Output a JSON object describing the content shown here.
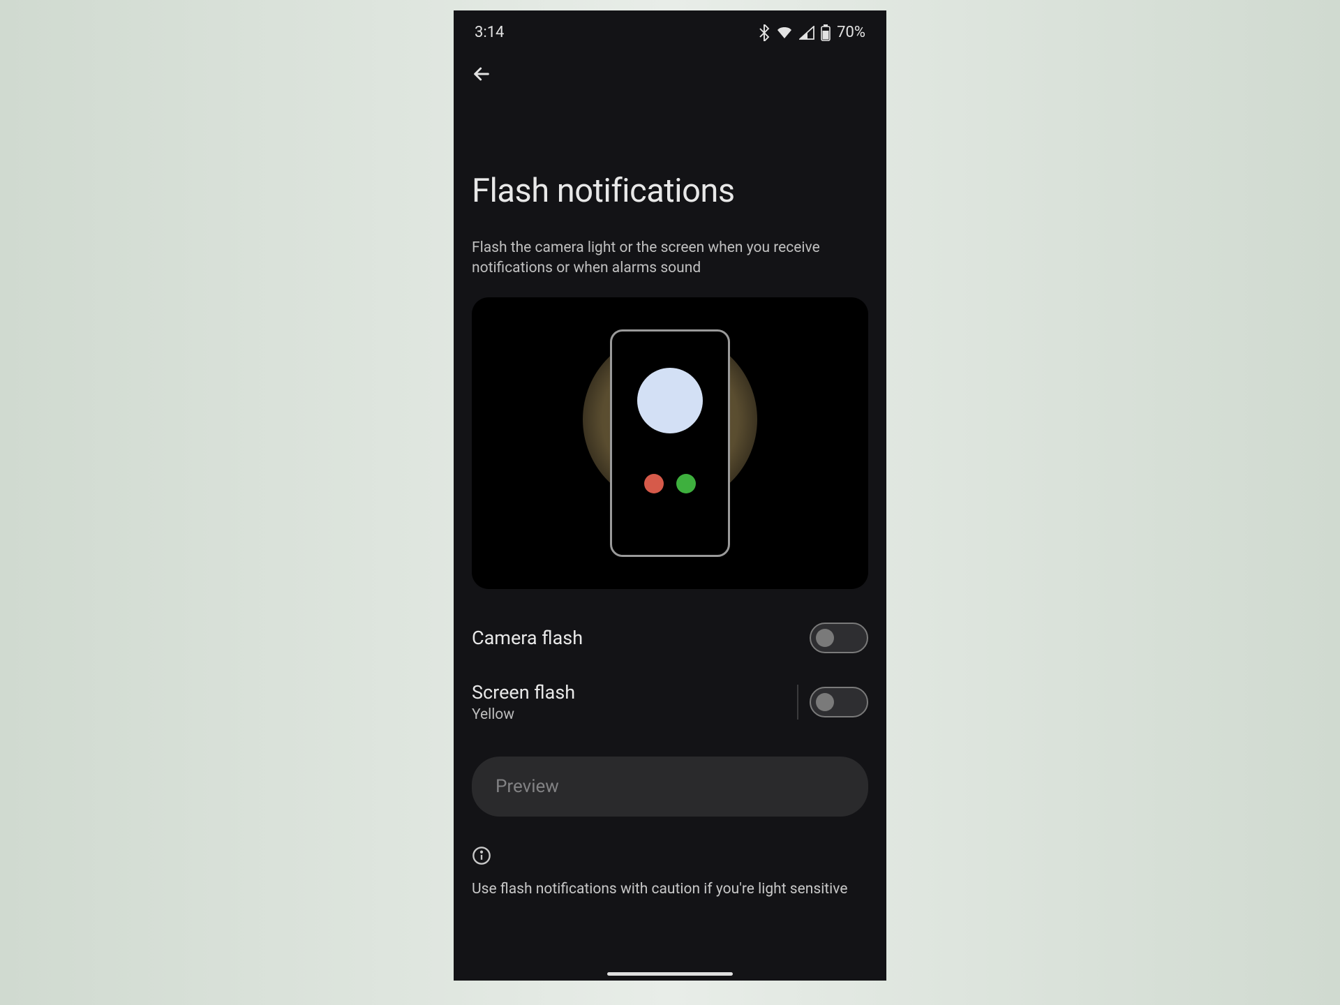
{
  "status": {
    "time": "3:14",
    "battery": "70%"
  },
  "page": {
    "title": "Flash notifications",
    "description": "Flash the camera light or the screen when you receive notifications or when alarms sound"
  },
  "settings": {
    "camera_flash": {
      "title": "Camera flash",
      "enabled": false
    },
    "screen_flash": {
      "title": "Screen flash",
      "subtitle": "Yellow",
      "enabled": false
    }
  },
  "preview_button": "Preview",
  "info_text": "Use flash notifications with caution if you're light sensitive"
}
